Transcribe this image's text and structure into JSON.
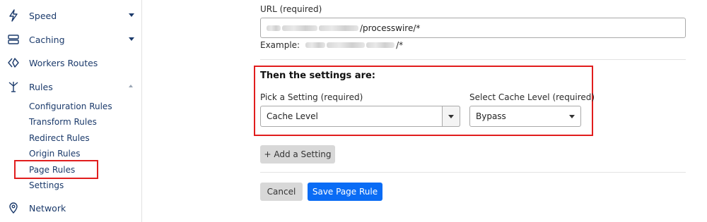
{
  "sidebar": {
    "items": [
      {
        "label": "Speed",
        "icon": "bolt-icon",
        "expanded": false
      },
      {
        "label": "Caching",
        "icon": "server-icon",
        "expanded": false
      },
      {
        "label": "Workers Routes",
        "icon": "workers-icon"
      },
      {
        "label": "Rules",
        "icon": "rules-fork-icon",
        "expanded": true
      },
      {
        "label": "Network",
        "icon": "location-pin-icon"
      }
    ],
    "rules_subitems": [
      "Configuration Rules",
      "Transform Rules",
      "Redirect Rules",
      "Origin Rules",
      "Page Rules",
      "Settings"
    ],
    "active_subitem": "Page Rules"
  },
  "form": {
    "url_label": "URL (required)",
    "url_value_visible": "/processwire/*",
    "example_prefix": "Example:",
    "example_suffix": "/*",
    "settings_title": "Then the settings are:",
    "pick_setting_label": "Pick a Setting (required)",
    "pick_setting_value": "Cache Level",
    "cache_level_label": "Select Cache Level (required)",
    "cache_level_value": "Bypass",
    "add_setting_label": "+ Add a Setting",
    "cancel_label": "Cancel",
    "save_label": "Save Page Rule"
  },
  "colors": {
    "nav_text": "#1b3a6b",
    "highlight": "#e11d1d",
    "primary_button": "#0a6cf5"
  }
}
